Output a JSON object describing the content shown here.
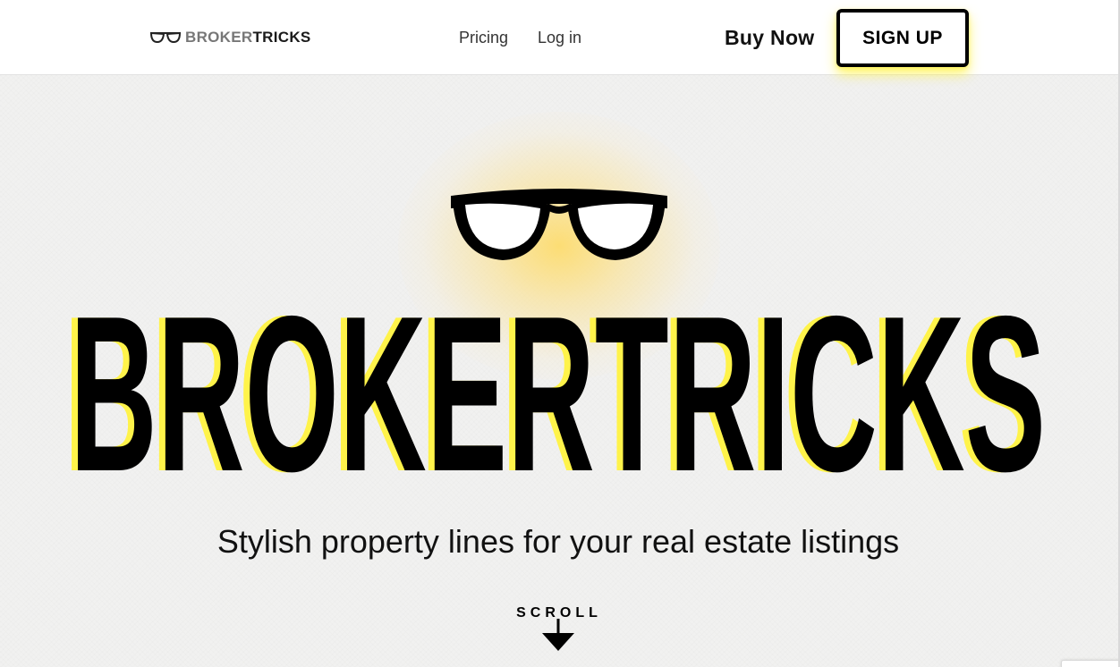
{
  "header": {
    "logo": {
      "icon": "glasses-icon",
      "text_part1": "BROKER",
      "text_part2": "TRICKS"
    },
    "nav": [
      {
        "label": "Pricing"
      },
      {
        "label": "Log in"
      }
    ],
    "buy_now_label": "Buy Now",
    "signup_label": "SIGN UP"
  },
  "hero": {
    "icon": "glasses-icon",
    "wordmark": "BROKERTRICKS",
    "tagline": "Stylish property lines for your real estate listings",
    "scroll_label": "SCROLL",
    "scroll_icon": "arrow-down-icon"
  },
  "colors": {
    "accent_yellow": "#fff34a",
    "glow": "#fcd87a",
    "text": "#000000",
    "background": "#f1f1f0"
  }
}
